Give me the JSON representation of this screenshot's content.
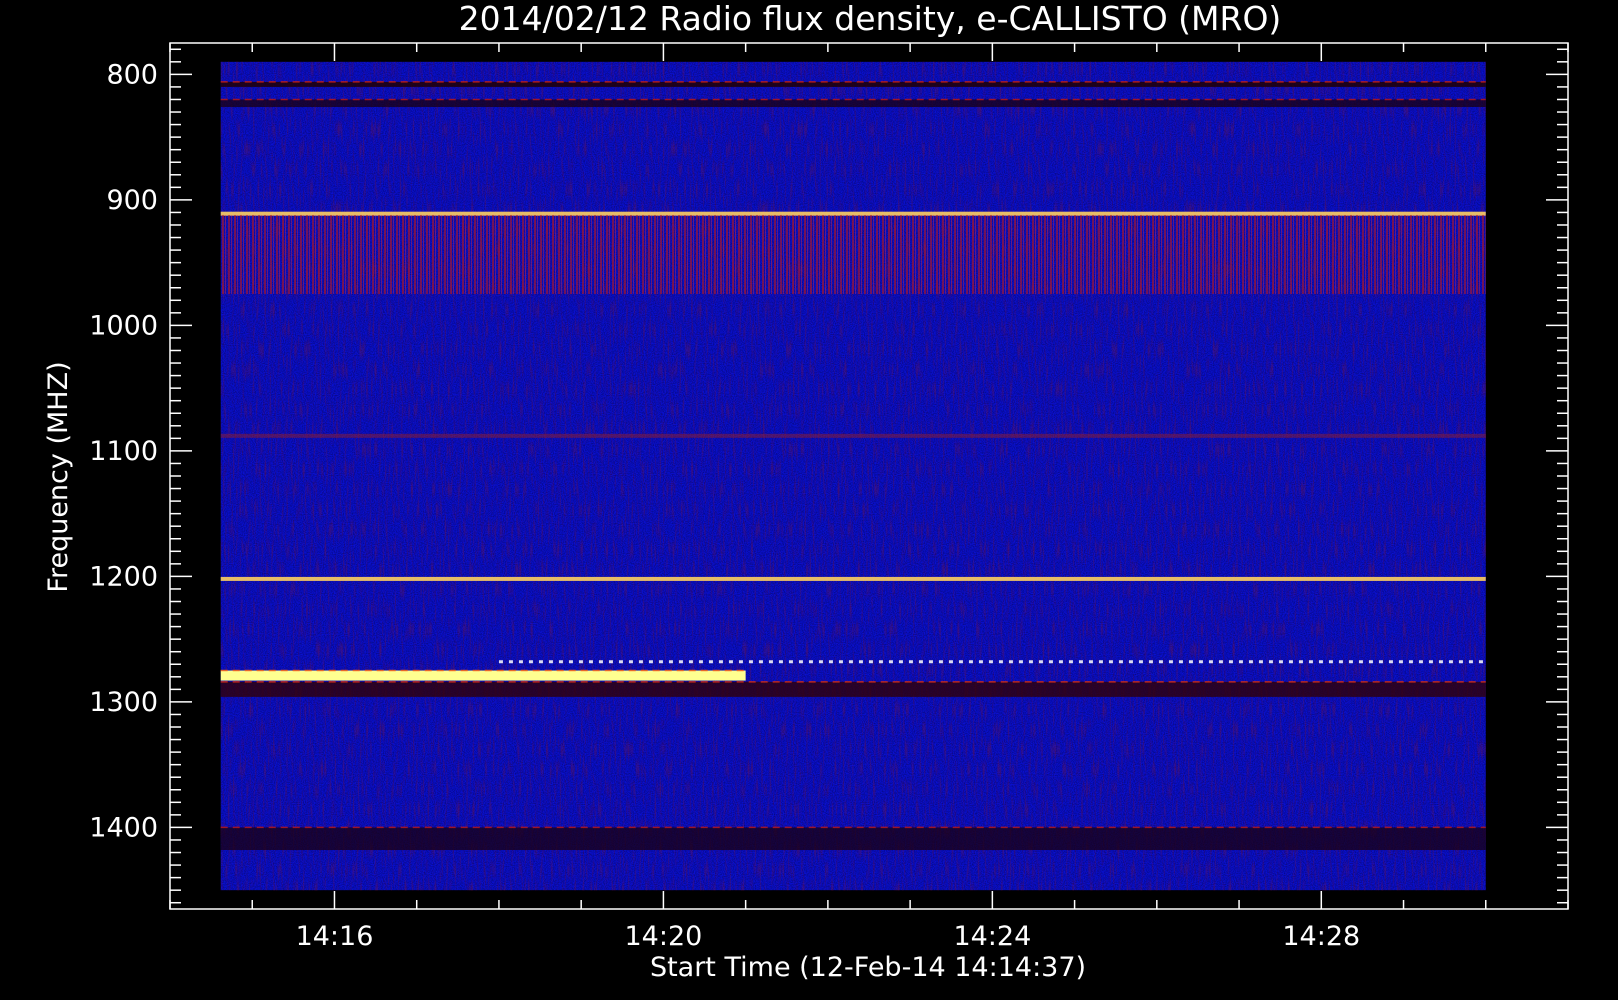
{
  "chart_data": {
    "type": "heatmap",
    "title": "2014/02/12  Radio flux density, e-CALLISTO (MRO)",
    "xlabel": "Start Time (12-Feb-14 14:14:37)",
    "ylabel": "Frequency (MHZ)",
    "x_range_minutes": [
      "14:14:37",
      "14:30:00"
    ],
    "x_axis_extent": [
      "14:14:00",
      "14:31:00"
    ],
    "y_range_mhz": [
      790,
      1450
    ],
    "y_axis_extent": [
      775,
      1465
    ],
    "y_inverted": true,
    "x_ticks": [
      "14:16",
      "14:20",
      "14:24",
      "14:28"
    ],
    "y_ticks": [
      "800",
      "900",
      "1000",
      "1100",
      "1200",
      "1300",
      "1400"
    ],
    "colormap": {
      "low": "#000000",
      "background": "#0a10d0",
      "mid": "#c01010",
      "high": "#ffff80"
    },
    "features": [
      {
        "name": "band",
        "freq_mhz": [
          806,
          810
        ],
        "start": "14:14:37",
        "end": "14:30:00",
        "intensity": "strong-dark-red"
      },
      {
        "name": "band",
        "freq_mhz": [
          820,
          826
        ],
        "start": "14:14:37",
        "end": "14:30:00",
        "intensity": "dark-red"
      },
      {
        "name": "line",
        "freq_mhz": 911,
        "start": "14:14:37",
        "end": "14:30:00",
        "intensity": "yellow-speckled"
      },
      {
        "name": "band",
        "freq_mhz": [
          912,
          975
        ],
        "start": "14:14:37",
        "end": "14:30:00",
        "intensity": "red-striations"
      },
      {
        "name": "line",
        "freq_mhz": 1088,
        "start": "14:14:37",
        "end": "14:30:00",
        "intensity": "faint-red"
      },
      {
        "name": "line",
        "freq_mhz": 1202,
        "start": "14:14:37",
        "end": "14:30:00",
        "intensity": "yellow-speckled"
      },
      {
        "name": "line",
        "freq_mhz": 1268,
        "start": "14:18:00",
        "end": "14:30:00",
        "intensity": "white-dashed"
      },
      {
        "name": "burst",
        "freq_mhz": [
          1275,
          1283
        ],
        "start": "14:14:37",
        "end": "14:21:00",
        "intensity": "bright-yellow"
      },
      {
        "name": "band",
        "freq_mhz": [
          1284,
          1296
        ],
        "start": "14:14:37",
        "end": "14:30:00",
        "intensity": "red-dark"
      },
      {
        "name": "band",
        "freq_mhz": [
          1400,
          1418
        ],
        "start": "14:14:37",
        "end": "14:30:00",
        "intensity": "dark-red"
      }
    ]
  }
}
